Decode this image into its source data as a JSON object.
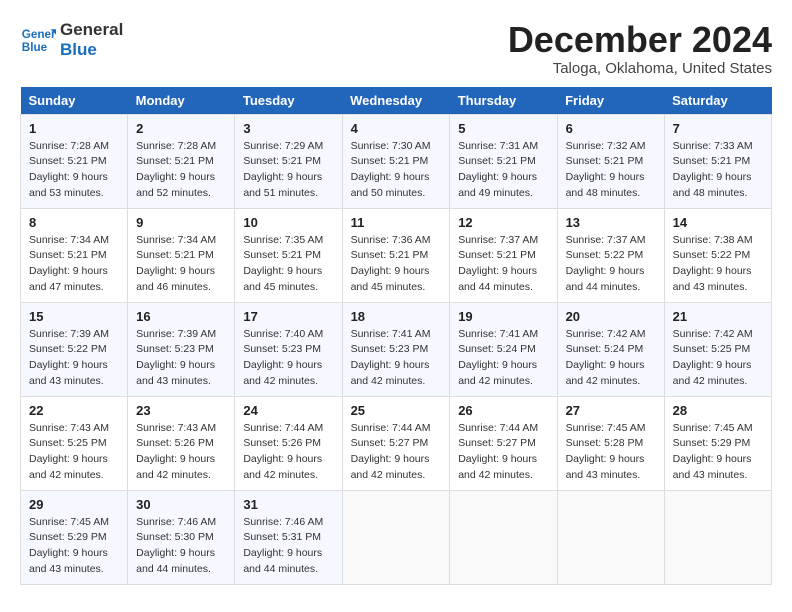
{
  "header": {
    "logo_line1": "General",
    "logo_line2": "Blue",
    "month": "December 2024",
    "location": "Taloga, Oklahoma, United States"
  },
  "weekdays": [
    "Sunday",
    "Monday",
    "Tuesday",
    "Wednesday",
    "Thursday",
    "Friday",
    "Saturday"
  ],
  "weeks": [
    [
      {
        "day": "1",
        "sunrise": "7:28 AM",
        "sunset": "5:21 PM",
        "daylight": "9 hours and 53 minutes."
      },
      {
        "day": "2",
        "sunrise": "7:28 AM",
        "sunset": "5:21 PM",
        "daylight": "9 hours and 52 minutes."
      },
      {
        "day": "3",
        "sunrise": "7:29 AM",
        "sunset": "5:21 PM",
        "daylight": "9 hours and 51 minutes."
      },
      {
        "day": "4",
        "sunrise": "7:30 AM",
        "sunset": "5:21 PM",
        "daylight": "9 hours and 50 minutes."
      },
      {
        "day": "5",
        "sunrise": "7:31 AM",
        "sunset": "5:21 PM",
        "daylight": "9 hours and 49 minutes."
      },
      {
        "day": "6",
        "sunrise": "7:32 AM",
        "sunset": "5:21 PM",
        "daylight": "9 hours and 48 minutes."
      },
      {
        "day": "7",
        "sunrise": "7:33 AM",
        "sunset": "5:21 PM",
        "daylight": "9 hours and 48 minutes."
      }
    ],
    [
      {
        "day": "8",
        "sunrise": "7:34 AM",
        "sunset": "5:21 PM",
        "daylight": "9 hours and 47 minutes."
      },
      {
        "day": "9",
        "sunrise": "7:34 AM",
        "sunset": "5:21 PM",
        "daylight": "9 hours and 46 minutes."
      },
      {
        "day": "10",
        "sunrise": "7:35 AM",
        "sunset": "5:21 PM",
        "daylight": "9 hours and 45 minutes."
      },
      {
        "day": "11",
        "sunrise": "7:36 AM",
        "sunset": "5:21 PM",
        "daylight": "9 hours and 45 minutes."
      },
      {
        "day": "12",
        "sunrise": "7:37 AM",
        "sunset": "5:21 PM",
        "daylight": "9 hours and 44 minutes."
      },
      {
        "day": "13",
        "sunrise": "7:37 AM",
        "sunset": "5:22 PM",
        "daylight": "9 hours and 44 minutes."
      },
      {
        "day": "14",
        "sunrise": "7:38 AM",
        "sunset": "5:22 PM",
        "daylight": "9 hours and 43 minutes."
      }
    ],
    [
      {
        "day": "15",
        "sunrise": "7:39 AM",
        "sunset": "5:22 PM",
        "daylight": "9 hours and 43 minutes."
      },
      {
        "day": "16",
        "sunrise": "7:39 AM",
        "sunset": "5:23 PM",
        "daylight": "9 hours and 43 minutes."
      },
      {
        "day": "17",
        "sunrise": "7:40 AM",
        "sunset": "5:23 PM",
        "daylight": "9 hours and 42 minutes."
      },
      {
        "day": "18",
        "sunrise": "7:41 AM",
        "sunset": "5:23 PM",
        "daylight": "9 hours and 42 minutes."
      },
      {
        "day": "19",
        "sunrise": "7:41 AM",
        "sunset": "5:24 PM",
        "daylight": "9 hours and 42 minutes."
      },
      {
        "day": "20",
        "sunrise": "7:42 AM",
        "sunset": "5:24 PM",
        "daylight": "9 hours and 42 minutes."
      },
      {
        "day": "21",
        "sunrise": "7:42 AM",
        "sunset": "5:25 PM",
        "daylight": "9 hours and 42 minutes."
      }
    ],
    [
      {
        "day": "22",
        "sunrise": "7:43 AM",
        "sunset": "5:25 PM",
        "daylight": "9 hours and 42 minutes."
      },
      {
        "day": "23",
        "sunrise": "7:43 AM",
        "sunset": "5:26 PM",
        "daylight": "9 hours and 42 minutes."
      },
      {
        "day": "24",
        "sunrise": "7:44 AM",
        "sunset": "5:26 PM",
        "daylight": "9 hours and 42 minutes."
      },
      {
        "day": "25",
        "sunrise": "7:44 AM",
        "sunset": "5:27 PM",
        "daylight": "9 hours and 42 minutes."
      },
      {
        "day": "26",
        "sunrise": "7:44 AM",
        "sunset": "5:27 PM",
        "daylight": "9 hours and 42 minutes."
      },
      {
        "day": "27",
        "sunrise": "7:45 AM",
        "sunset": "5:28 PM",
        "daylight": "9 hours and 43 minutes."
      },
      {
        "day": "28",
        "sunrise": "7:45 AM",
        "sunset": "5:29 PM",
        "daylight": "9 hours and 43 minutes."
      }
    ],
    [
      {
        "day": "29",
        "sunrise": "7:45 AM",
        "sunset": "5:29 PM",
        "daylight": "9 hours and 43 minutes."
      },
      {
        "day": "30",
        "sunrise": "7:46 AM",
        "sunset": "5:30 PM",
        "daylight": "9 hours and 44 minutes."
      },
      {
        "day": "31",
        "sunrise": "7:46 AM",
        "sunset": "5:31 PM",
        "daylight": "9 hours and 44 minutes."
      },
      null,
      null,
      null,
      null
    ]
  ],
  "labels": {
    "sunrise": "Sunrise: ",
    "sunset": "Sunset: ",
    "daylight": "Daylight: "
  }
}
